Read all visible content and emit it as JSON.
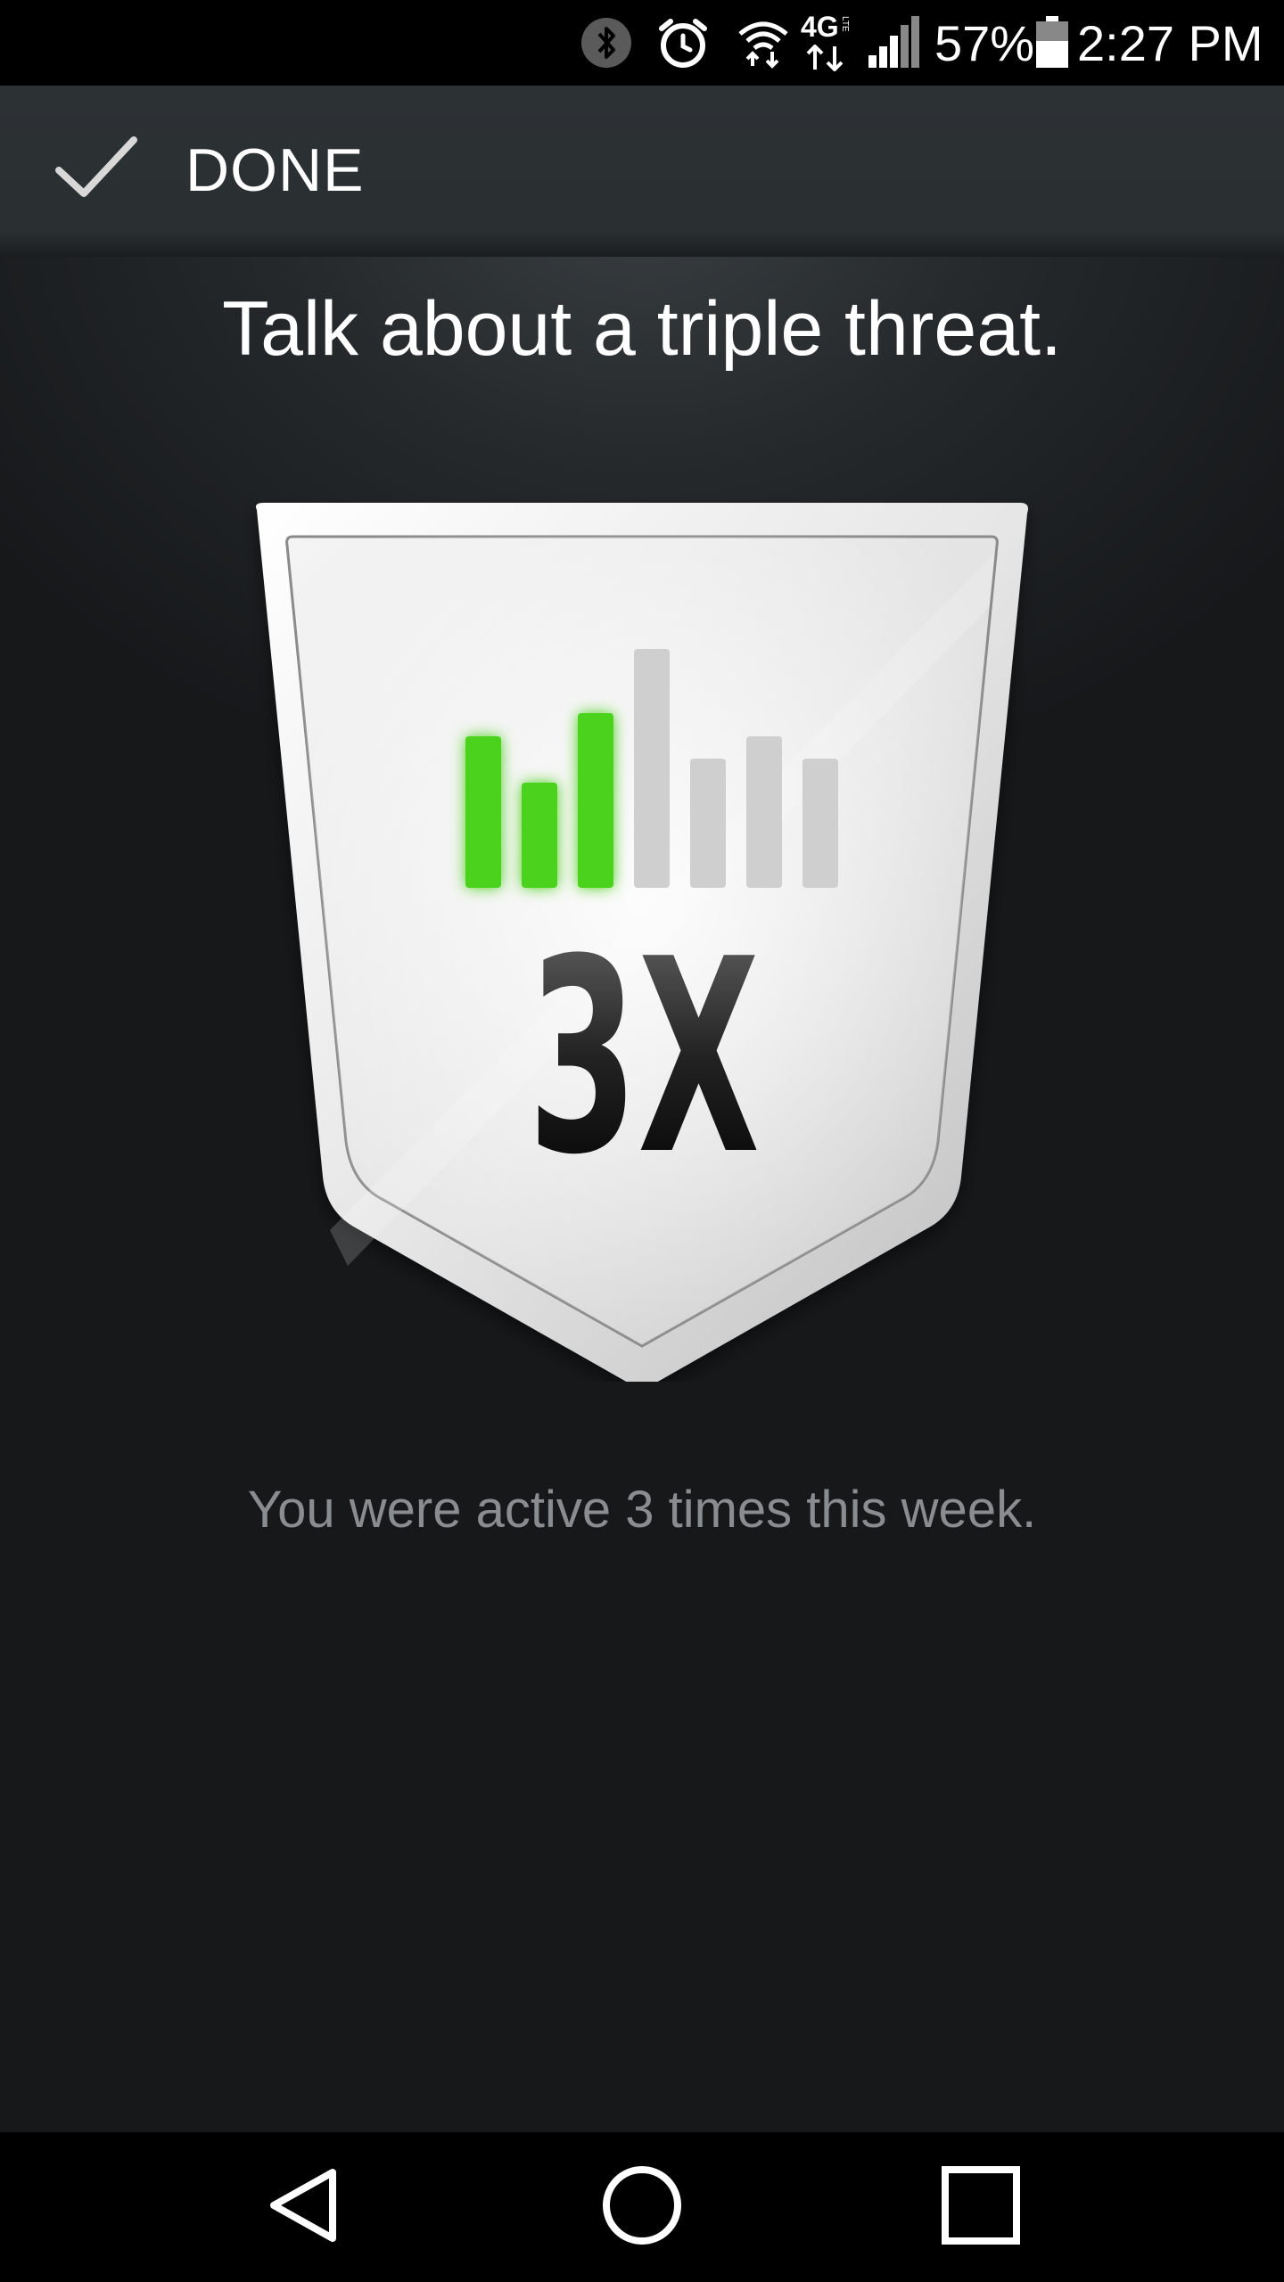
{
  "status_bar": {
    "bluetooth_icon": "bluetooth-icon",
    "alarm_icon": "alarm-icon",
    "wifi_icon": "wifi-icon",
    "network_type": "4G",
    "network_subtype": "LTE",
    "signal_icon": "cell-signal-icon",
    "battery_percent": "57%",
    "battery_icon": "battery-icon",
    "time": "2:27 PM"
  },
  "action_bar": {
    "done_icon": "checkmark-icon",
    "done_label": "DONE"
  },
  "main": {
    "headline": "Talk about a triple threat.",
    "badge": {
      "label": "3X",
      "activity_bars": {
        "total_days": 7,
        "active_days": 3,
        "active_color": "#4cd21e",
        "inactive_color": "#cfcfcf"
      }
    },
    "subtitle": "You were active 3 times this week."
  },
  "nav_bar": {
    "back_icon": "back-triangle-icon",
    "home_icon": "home-circle-icon",
    "recents_icon": "recents-square-icon"
  }
}
